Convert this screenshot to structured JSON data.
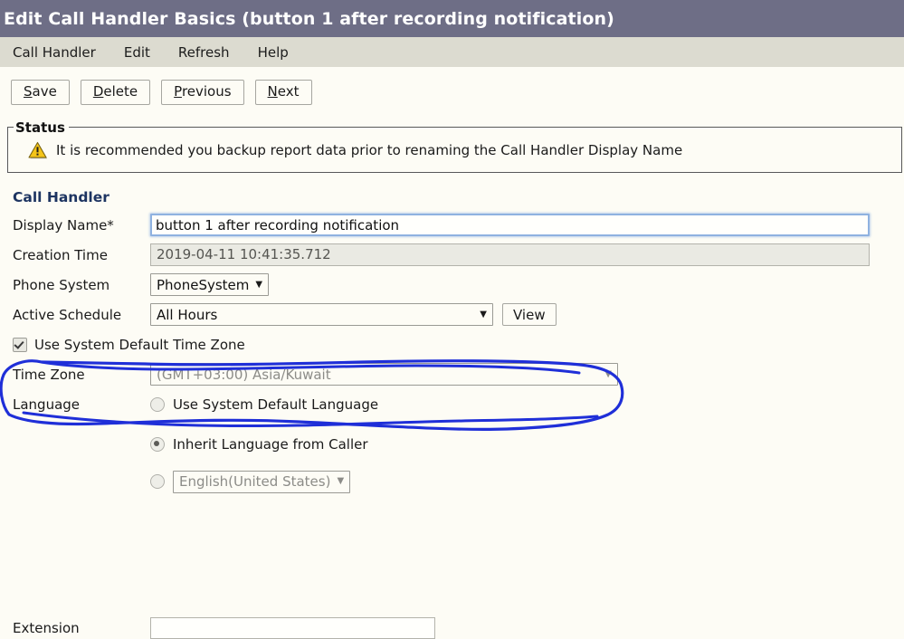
{
  "window": {
    "title": "Edit Call Handler Basics  (button 1 after recording notification)"
  },
  "menubar": {
    "items": [
      {
        "label": "Call Handler"
      },
      {
        "label": "Edit"
      },
      {
        "label": "Refresh"
      },
      {
        "label": "Help"
      }
    ]
  },
  "toolbar": {
    "buttons": [
      {
        "prefix": "",
        "accesskey": "S",
        "suffix": "ave"
      },
      {
        "prefix": "",
        "accesskey": "D",
        "suffix": "elete"
      },
      {
        "prefix": "",
        "accesskey": "P",
        "suffix": "revious"
      },
      {
        "prefix": "",
        "accesskey": "N",
        "suffix": "ext"
      }
    ]
  },
  "status": {
    "legend": "Status",
    "icon": "warning-triangle-icon",
    "message": "It is recommended you backup report data prior to renaming the Call Handler Display Name"
  },
  "form": {
    "heading": "Call Handler",
    "display_name": {
      "label": "Display Name*",
      "value": "button 1 after recording notification"
    },
    "creation_time": {
      "label": "Creation Time",
      "value": "2019-04-11 10:41:35.712"
    },
    "phone_system": {
      "label": "Phone System",
      "value": "PhoneSystem"
    },
    "active_schedule": {
      "label": "Active Schedule",
      "value": "All Hours",
      "view_button": "View"
    },
    "use_system_default_time_zone": {
      "label": "Use System Default Time Zone",
      "checked": true
    },
    "time_zone": {
      "label": "Time Zone",
      "value": "(GMT+03:00) Asia/Kuwait"
    },
    "language": {
      "label": "Language",
      "options": [
        {
          "label": "Use System Default Language",
          "selected": false
        },
        {
          "label": "Inherit Language from Caller",
          "selected": true
        },
        {
          "label": "English(United States)",
          "selected": false,
          "is_select": true
        }
      ]
    },
    "extension": {
      "label": "Extension",
      "value": ""
    }
  },
  "annotation": {
    "name": "blue-hand-drawn-ellipse",
    "color": "#1f2fd8",
    "target": "Active Schedule row"
  },
  "colors": {
    "titlebar_bg": "#6e6e86",
    "menubar_bg": "#dcdbd0",
    "page_bg": "#fdfcf5",
    "heading": "#1d3461",
    "annotation": "#1f2fd8"
  }
}
